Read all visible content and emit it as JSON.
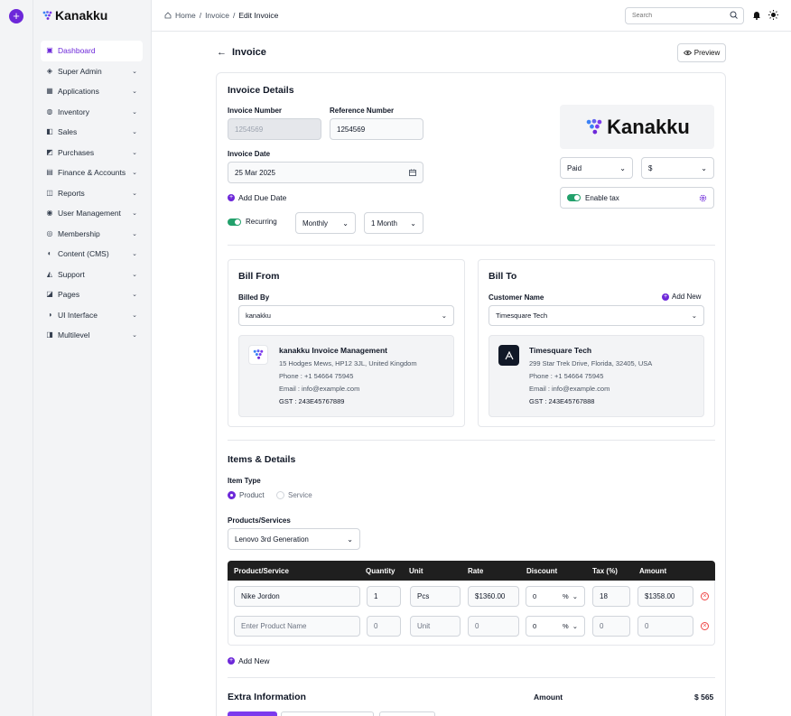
{
  "brand": {
    "name": "Kanakku"
  },
  "sidebar": {
    "items": [
      {
        "label": "Dashboard",
        "icon": "dashboard-icon",
        "active": true
      },
      {
        "label": "Super Admin",
        "icon": "super-admin-icon"
      },
      {
        "label": "Applications",
        "icon": "grid-icon"
      },
      {
        "label": "Inventory",
        "icon": "inventory-icon"
      },
      {
        "label": "Sales",
        "icon": "sales-icon"
      },
      {
        "label": "Purchases",
        "icon": "purchases-icon"
      },
      {
        "label": "Finance & Accounts",
        "icon": "finance-icon"
      },
      {
        "label": "Reports",
        "icon": "reports-icon"
      },
      {
        "label": "User Management",
        "icon": "user-icon"
      },
      {
        "label": "Membership",
        "icon": "membership-icon"
      },
      {
        "label": "Content (CMS)",
        "icon": "cms-icon"
      },
      {
        "label": "Support",
        "icon": "support-icon"
      },
      {
        "label": "Pages",
        "icon": "pages-icon"
      },
      {
        "label": "UI Interface",
        "icon": "ui-icon"
      },
      {
        "label": "Multilevel",
        "icon": "multilevel-icon"
      }
    ]
  },
  "topbar": {
    "breadcrumb": [
      "Home",
      "Invoice",
      "Edit Invoice"
    ],
    "search_placeholder": "Search"
  },
  "page": {
    "title": "Invoice",
    "preview_label": "Preview"
  },
  "details": {
    "title": "Invoice Details",
    "invoice_number_label": "Invoice Number",
    "invoice_number_value": "1254569",
    "reference_number_label": "Reference Number",
    "reference_number_value": "1254569",
    "invoice_date_label": "Invoice Date",
    "invoice_date_value": "25 Mar 2025",
    "add_due_date": "Add Due Date",
    "recurring_label": "Recurring",
    "recurring_period": "Monthly",
    "recurring_count": "1 Month",
    "status": "Paid",
    "currency": "$",
    "enable_tax": "Enable tax"
  },
  "bill_from": {
    "title": "Bill From",
    "billed_by_label": "Billed By",
    "billed_by_value": "kanakku",
    "name": "kanakku Invoice Management",
    "address": "15 Hodges Mews, HP12 3JL, United Kingdom",
    "phone": "Phone : +1 54664 75945",
    "email": "Email : info@example.com",
    "gst": "GST : 243E45767889"
  },
  "bill_to": {
    "title": "Bill To",
    "customer_label": "Customer Name",
    "add_new": "Add New",
    "customer_value": "Timesquare Tech",
    "name": "Timesquare Tech",
    "address": "299 Star Trek Drive, Florida, 32405, USA",
    "phone": "Phone : +1 54664 75945",
    "email": "Email : info@example.com",
    "gst": "GST : 243E45767888"
  },
  "items": {
    "title": "Items & Details",
    "item_type_label": "Item Type",
    "type_product": "Product",
    "type_service": "Service",
    "products_label": "Products/Services",
    "product_select": "Lenovo 3rd Generation",
    "columns": [
      "Product/Service",
      "Quantity",
      "Unit",
      "Rate",
      "Discount",
      "Tax (%)",
      "Amount"
    ],
    "rows": [
      {
        "product": "Nike Jordon",
        "qty": "1",
        "unit": "Pcs",
        "rate": "$1360.00",
        "discount": "0",
        "disc_type": "%",
        "tax": "18",
        "amount": "$1358.00",
        "placeholder": false
      },
      {
        "product": "Enter Product Name",
        "qty": "0",
        "unit": "Unit",
        "rate": "0",
        "discount": "0",
        "disc_type": "%",
        "tax": "0",
        "amount": "0",
        "placeholder": true
      }
    ],
    "add_new": "Add New"
  },
  "extra": {
    "title": "Extra Information",
    "amount_label": "Amount",
    "amount_value": "$ 565"
  },
  "colors": {
    "accent": "#6d28d9",
    "success": "#22a06b",
    "danger": "#ef4444",
    "table_header": "#1f1f1f"
  }
}
